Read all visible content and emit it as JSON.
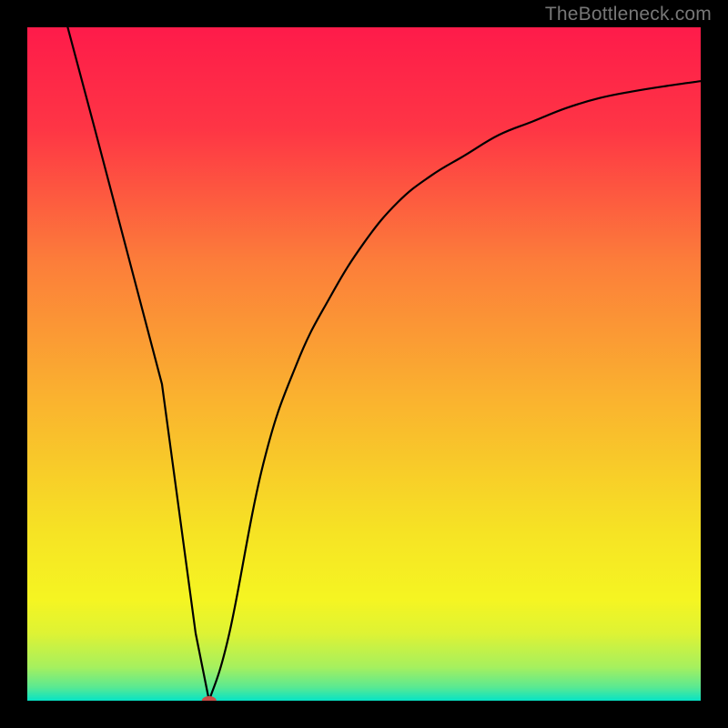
{
  "watermark": "TheBottleneck.com",
  "chart_data": {
    "type": "line",
    "title": "",
    "xlabel": "",
    "ylabel": "",
    "xlim": [
      0,
      100
    ],
    "ylim": [
      0,
      100
    ],
    "grid": false,
    "legend": false,
    "series": [
      {
        "name": "curve",
        "color": "#000000",
        "x": [
          6,
          10,
          15,
          20,
          25,
          27,
          30,
          35,
          40,
          45,
          50,
          55,
          60,
          65,
          70,
          75,
          80,
          85,
          90,
          95,
          100
        ],
        "y": [
          100,
          85,
          66,
          47,
          10,
          0,
          10,
          35,
          50,
          60,
          68,
          74,
          78,
          81,
          84,
          86,
          88,
          89.5,
          90.5,
          91.3,
          92
        ]
      }
    ],
    "marker": {
      "x": 27,
      "y": 0,
      "rx": 8,
      "ry": 5,
      "color": "#CC4E48"
    },
    "background_gradient": {
      "stops": [
        {
          "offset": 0.0,
          "color": "#FE1B4A"
        },
        {
          "offset": 0.15,
          "color": "#FE3545"
        },
        {
          "offset": 0.35,
          "color": "#FC7E3A"
        },
        {
          "offset": 0.55,
          "color": "#FAB22F"
        },
        {
          "offset": 0.75,
          "color": "#F6E324"
        },
        {
          "offset": 0.85,
          "color": "#F5F522"
        },
        {
          "offset": 0.9,
          "color": "#DEF334"
        },
        {
          "offset": 0.95,
          "color": "#A6F05E"
        },
        {
          "offset": 0.98,
          "color": "#5AE992"
        },
        {
          "offset": 1.0,
          "color": "#06E3C6"
        }
      ]
    }
  }
}
